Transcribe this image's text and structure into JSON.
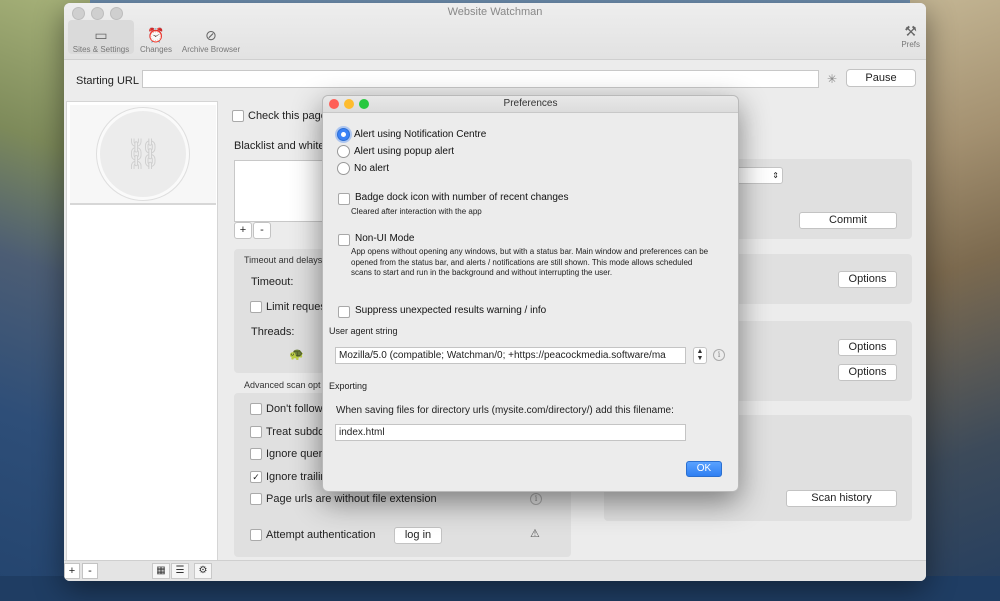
{
  "window": {
    "title": "Website Watchman",
    "toolbar": [
      {
        "label": "Sites & Settings",
        "icon": "window-icon"
      },
      {
        "label": "Changes",
        "icon": "alarm-clock-icon"
      },
      {
        "label": "Archive Browser",
        "icon": "compass-icon"
      }
    ],
    "prefs_label": "Prefs"
  },
  "urlbar": {
    "label": "Starting URL",
    "value": "",
    "pause_label": "Pause"
  },
  "sidebar": {
    "add": "+",
    "remove": "-"
  },
  "center": {
    "check_page": "Check this page",
    "blacklist": "Blacklist and white",
    "list_add": "+",
    "list_remove": "-",
    "timeout_section": "Timeout and delays",
    "timeout_label": "Timeout:",
    "limit_requests": "Limit reques",
    "threads_label": "Threads:",
    "advanced_section": "Advanced scan opt",
    "dont_follow": "Don't follow",
    "treat_subdomains": "Treat subdor",
    "ignore_query": "Ignore query",
    "ignore_trailing": "Ignore trailin",
    "page_urls_no_ext": "Page urls are without file extension",
    "attempt_auth": "Attempt authentication",
    "login_label": "log in"
  },
  "right": {
    "commit_label": "Commit",
    "options_label_1": "Options",
    "options_label_2": "Options",
    "options_label_3": "Options",
    "scan_history_label": "Scan history"
  },
  "preferences": {
    "title": "Preferences",
    "alert_options": [
      {
        "label": "Alert using Notification Centre",
        "selected": true
      },
      {
        "label": "Alert using popup alert",
        "selected": false
      },
      {
        "label": "No alert",
        "selected": false
      }
    ],
    "badge_label": "Badge dock icon with number of recent changes",
    "badge_note": "Cleared after interaction with the app",
    "nonui_label": "Non-UI Mode",
    "nonui_note": "App opens without opening any windows, but with a status bar. Main window and preferences can be opened from the status bar, and alerts / notifications are still shown. This mode allows scheduled scans to start and run in the background and without interrupting the user.",
    "suppress_label": "Suppress unexpected results warning / info",
    "ua_section": "User agent string",
    "ua_value": "Mozilla/5.0 (compatible; Watchman/0; +https://peacockmedia.software/ma",
    "exporting_section": "Exporting",
    "export_note": "When saving files for directory urls (mysite.com/directory/) add this filename:",
    "export_filename": "index.html",
    "ok_label": "OK"
  },
  "colors": {
    "accent": "#3b82f6",
    "close": "#ff5f57",
    "minimize": "#febc2e",
    "zoom": "#28c840"
  }
}
